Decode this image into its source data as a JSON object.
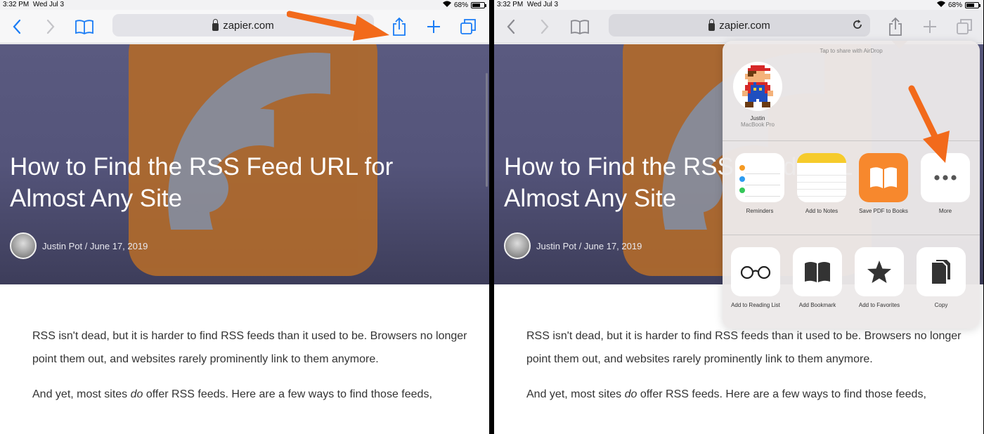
{
  "status": {
    "time": "3:32 PM",
    "date": "Wed Jul 3",
    "battery": "68%"
  },
  "toolbar": {
    "url": "zapier.com"
  },
  "article": {
    "title": "How to Find the RSS Feed URL for Almost Any Site",
    "byline": "Justin Pot / June 17, 2019",
    "p1": "RSS isn't dead, but it is harder to find RSS feeds than it used to be. Browsers no longer point them out, and websites rarely prominently link to them anymore.",
    "p2_pre": "And yet, most sites ",
    "p2_em": "do",
    "p2_post": " offer RSS feeds. Here are a few ways to find those feeds,"
  },
  "share_sheet": {
    "airdrop_hint": "Tap to share with AirDrop",
    "contact_name": "Justin",
    "contact_device": "MacBook Pro",
    "apps": {
      "reminders": "Reminders",
      "notes": "Add to Notes",
      "books": "Save PDF to Books",
      "more": "More"
    },
    "actions": {
      "reading_list": "Add to Reading List",
      "bookmark": "Add Bookmark",
      "favorites": "Add to Favorites",
      "copy": "Copy"
    }
  },
  "colors": {
    "accent": "#1a7cf5",
    "arrow": "#f26a1b",
    "hero": "#54547a"
  }
}
